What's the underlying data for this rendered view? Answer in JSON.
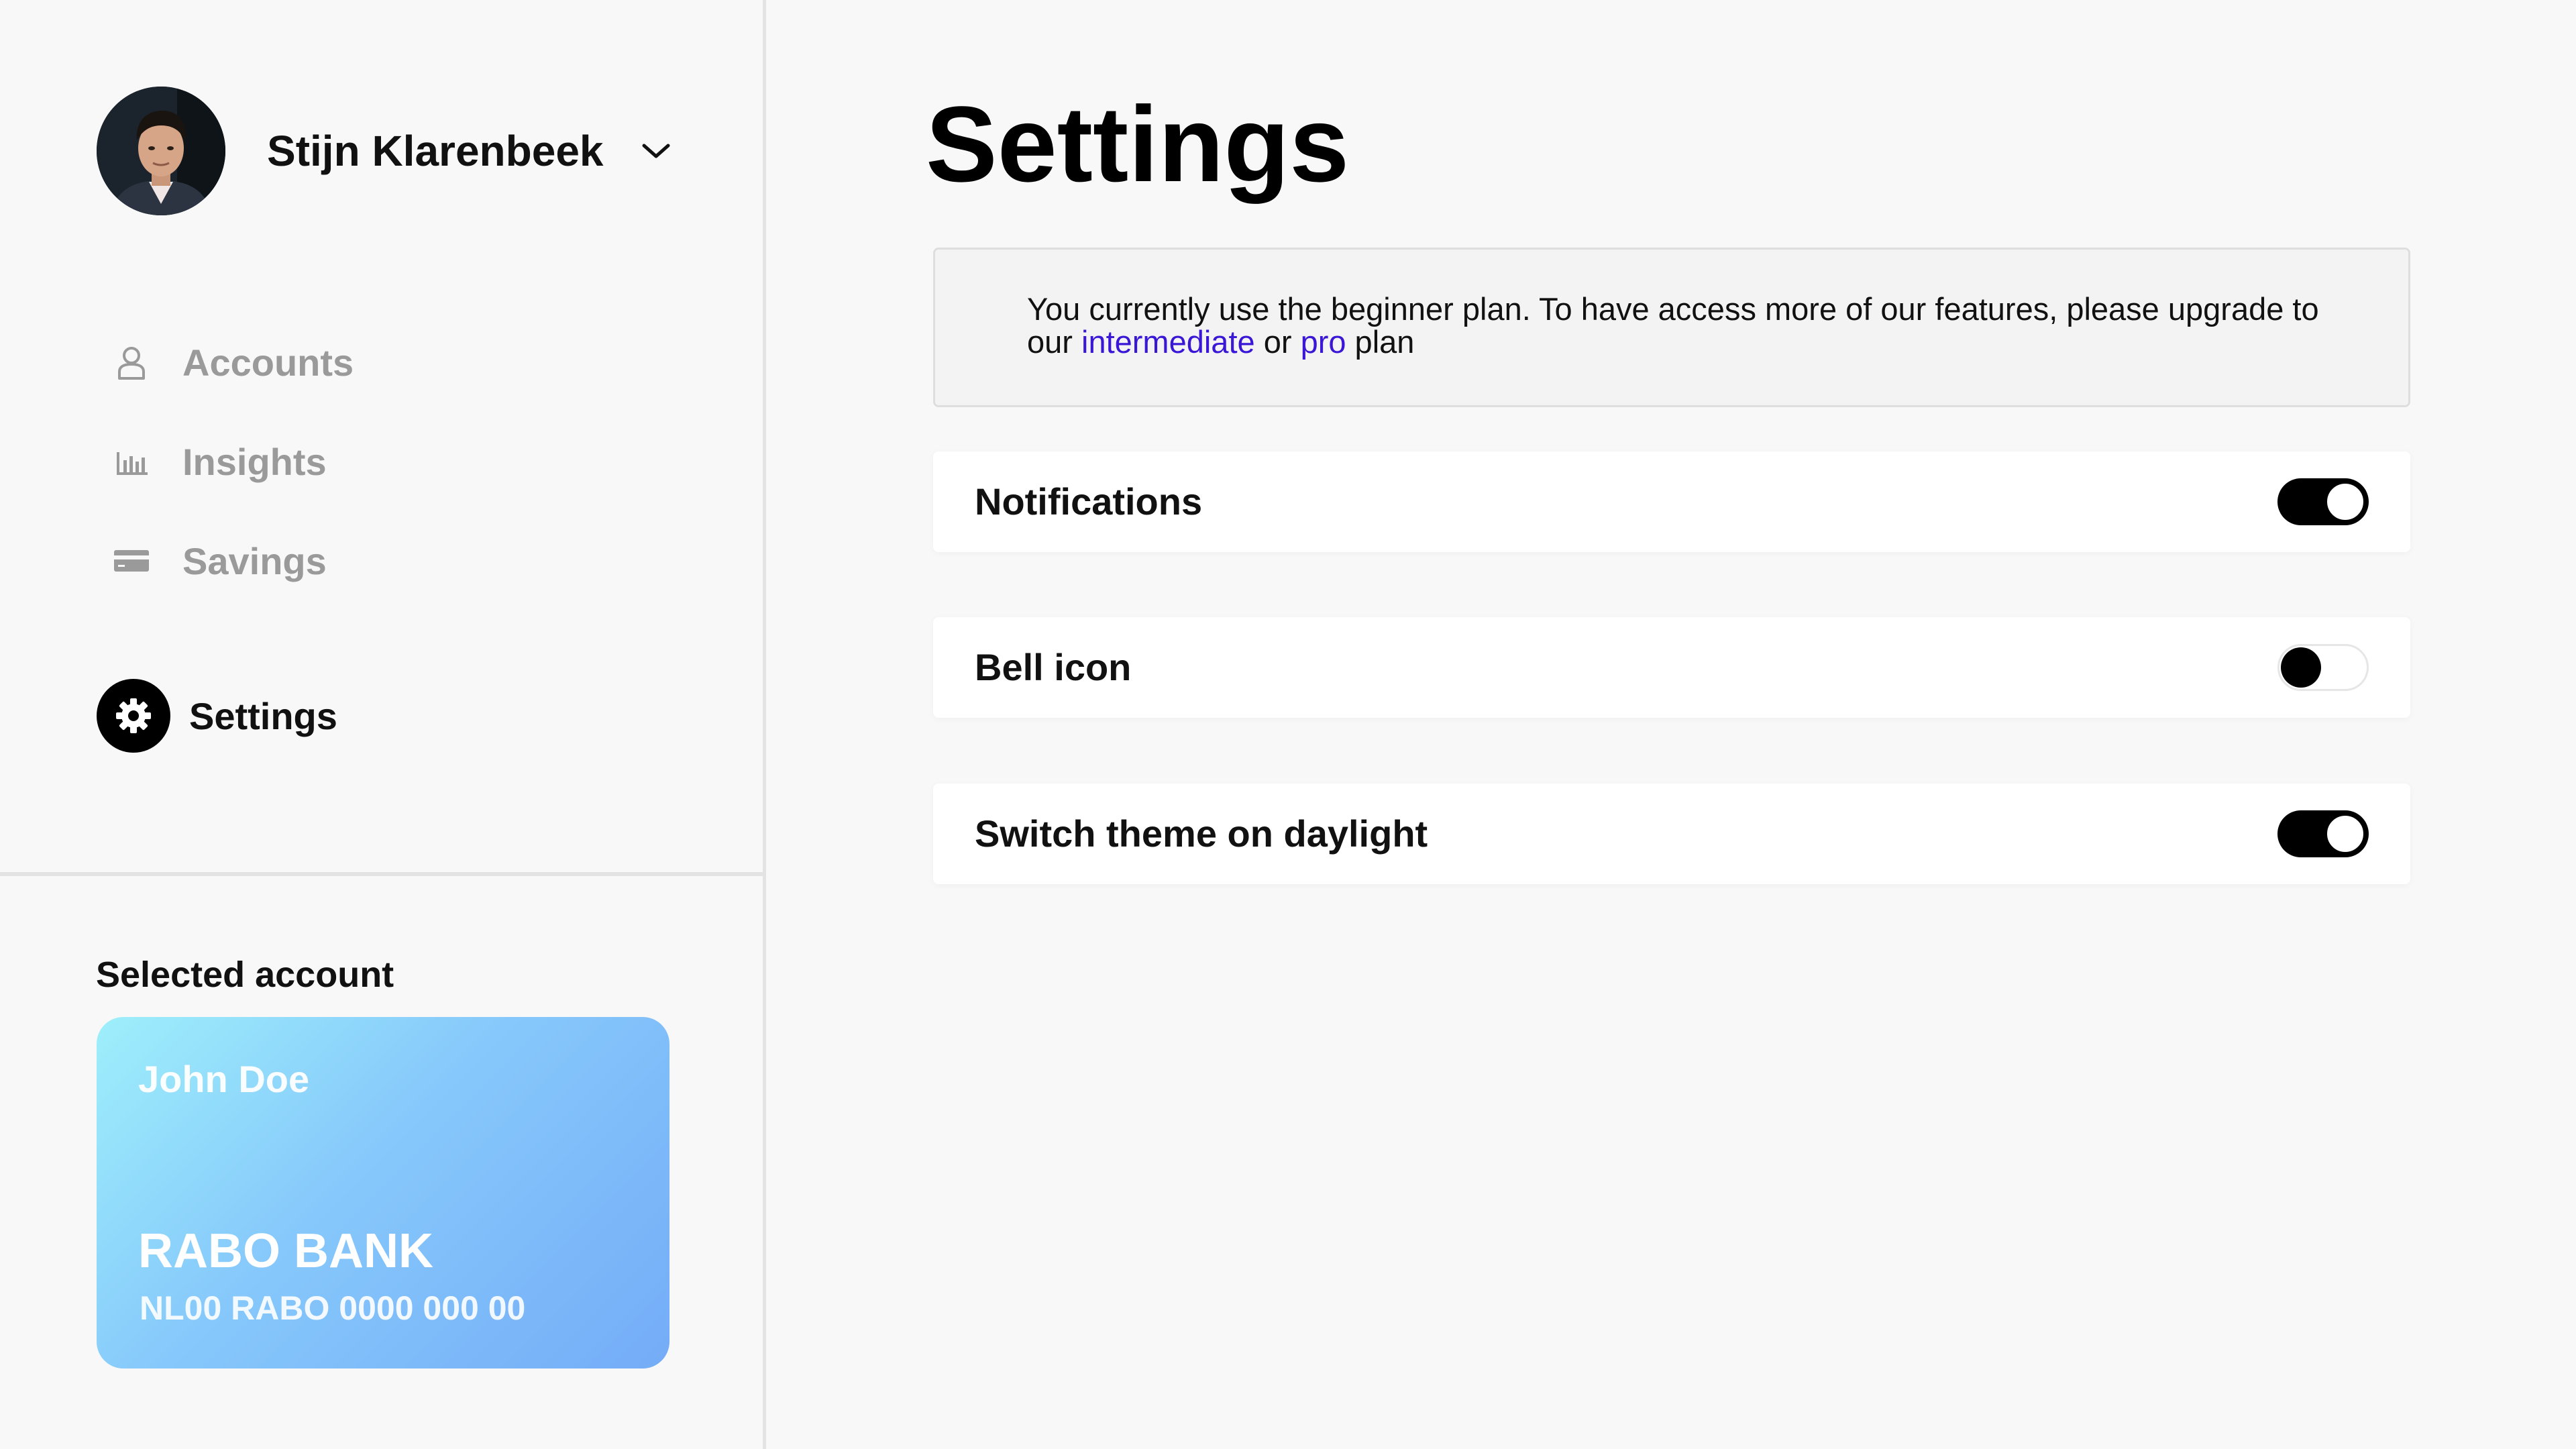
{
  "user": {
    "name": "Stijn Klarenbeek"
  },
  "nav": {
    "items": [
      {
        "label": "Accounts",
        "icon": "user-icon"
      },
      {
        "label": "Insights",
        "icon": "bar-chart-icon"
      },
      {
        "label": "Savings",
        "icon": "credit-card-icon"
      }
    ],
    "active": {
      "label": "Settings",
      "icon": "gear-icon"
    }
  },
  "selected_account": {
    "title": "Selected account",
    "holder": "John Doe",
    "bank": "RABO BANK",
    "iban": "NL00 RABO 0000 000 00",
    "gradient": [
      "#9eeffb",
      "#74acf7"
    ]
  },
  "page": {
    "title": "Settings"
  },
  "plan_banner": {
    "text_before": "You currently use the beginner plan. To have access more of our features, please upgrade to our ",
    "link_intermediate": "intermediate",
    "text_or": " or ",
    "link_pro": "pro",
    "text_after": " plan",
    "link_color": "#3a17d6"
  },
  "settings": [
    {
      "label": "Notifications",
      "enabled": true
    },
    {
      "label": "Bell icon",
      "enabled": false
    },
    {
      "label": "Switch theme on daylight",
      "enabled": true
    }
  ]
}
